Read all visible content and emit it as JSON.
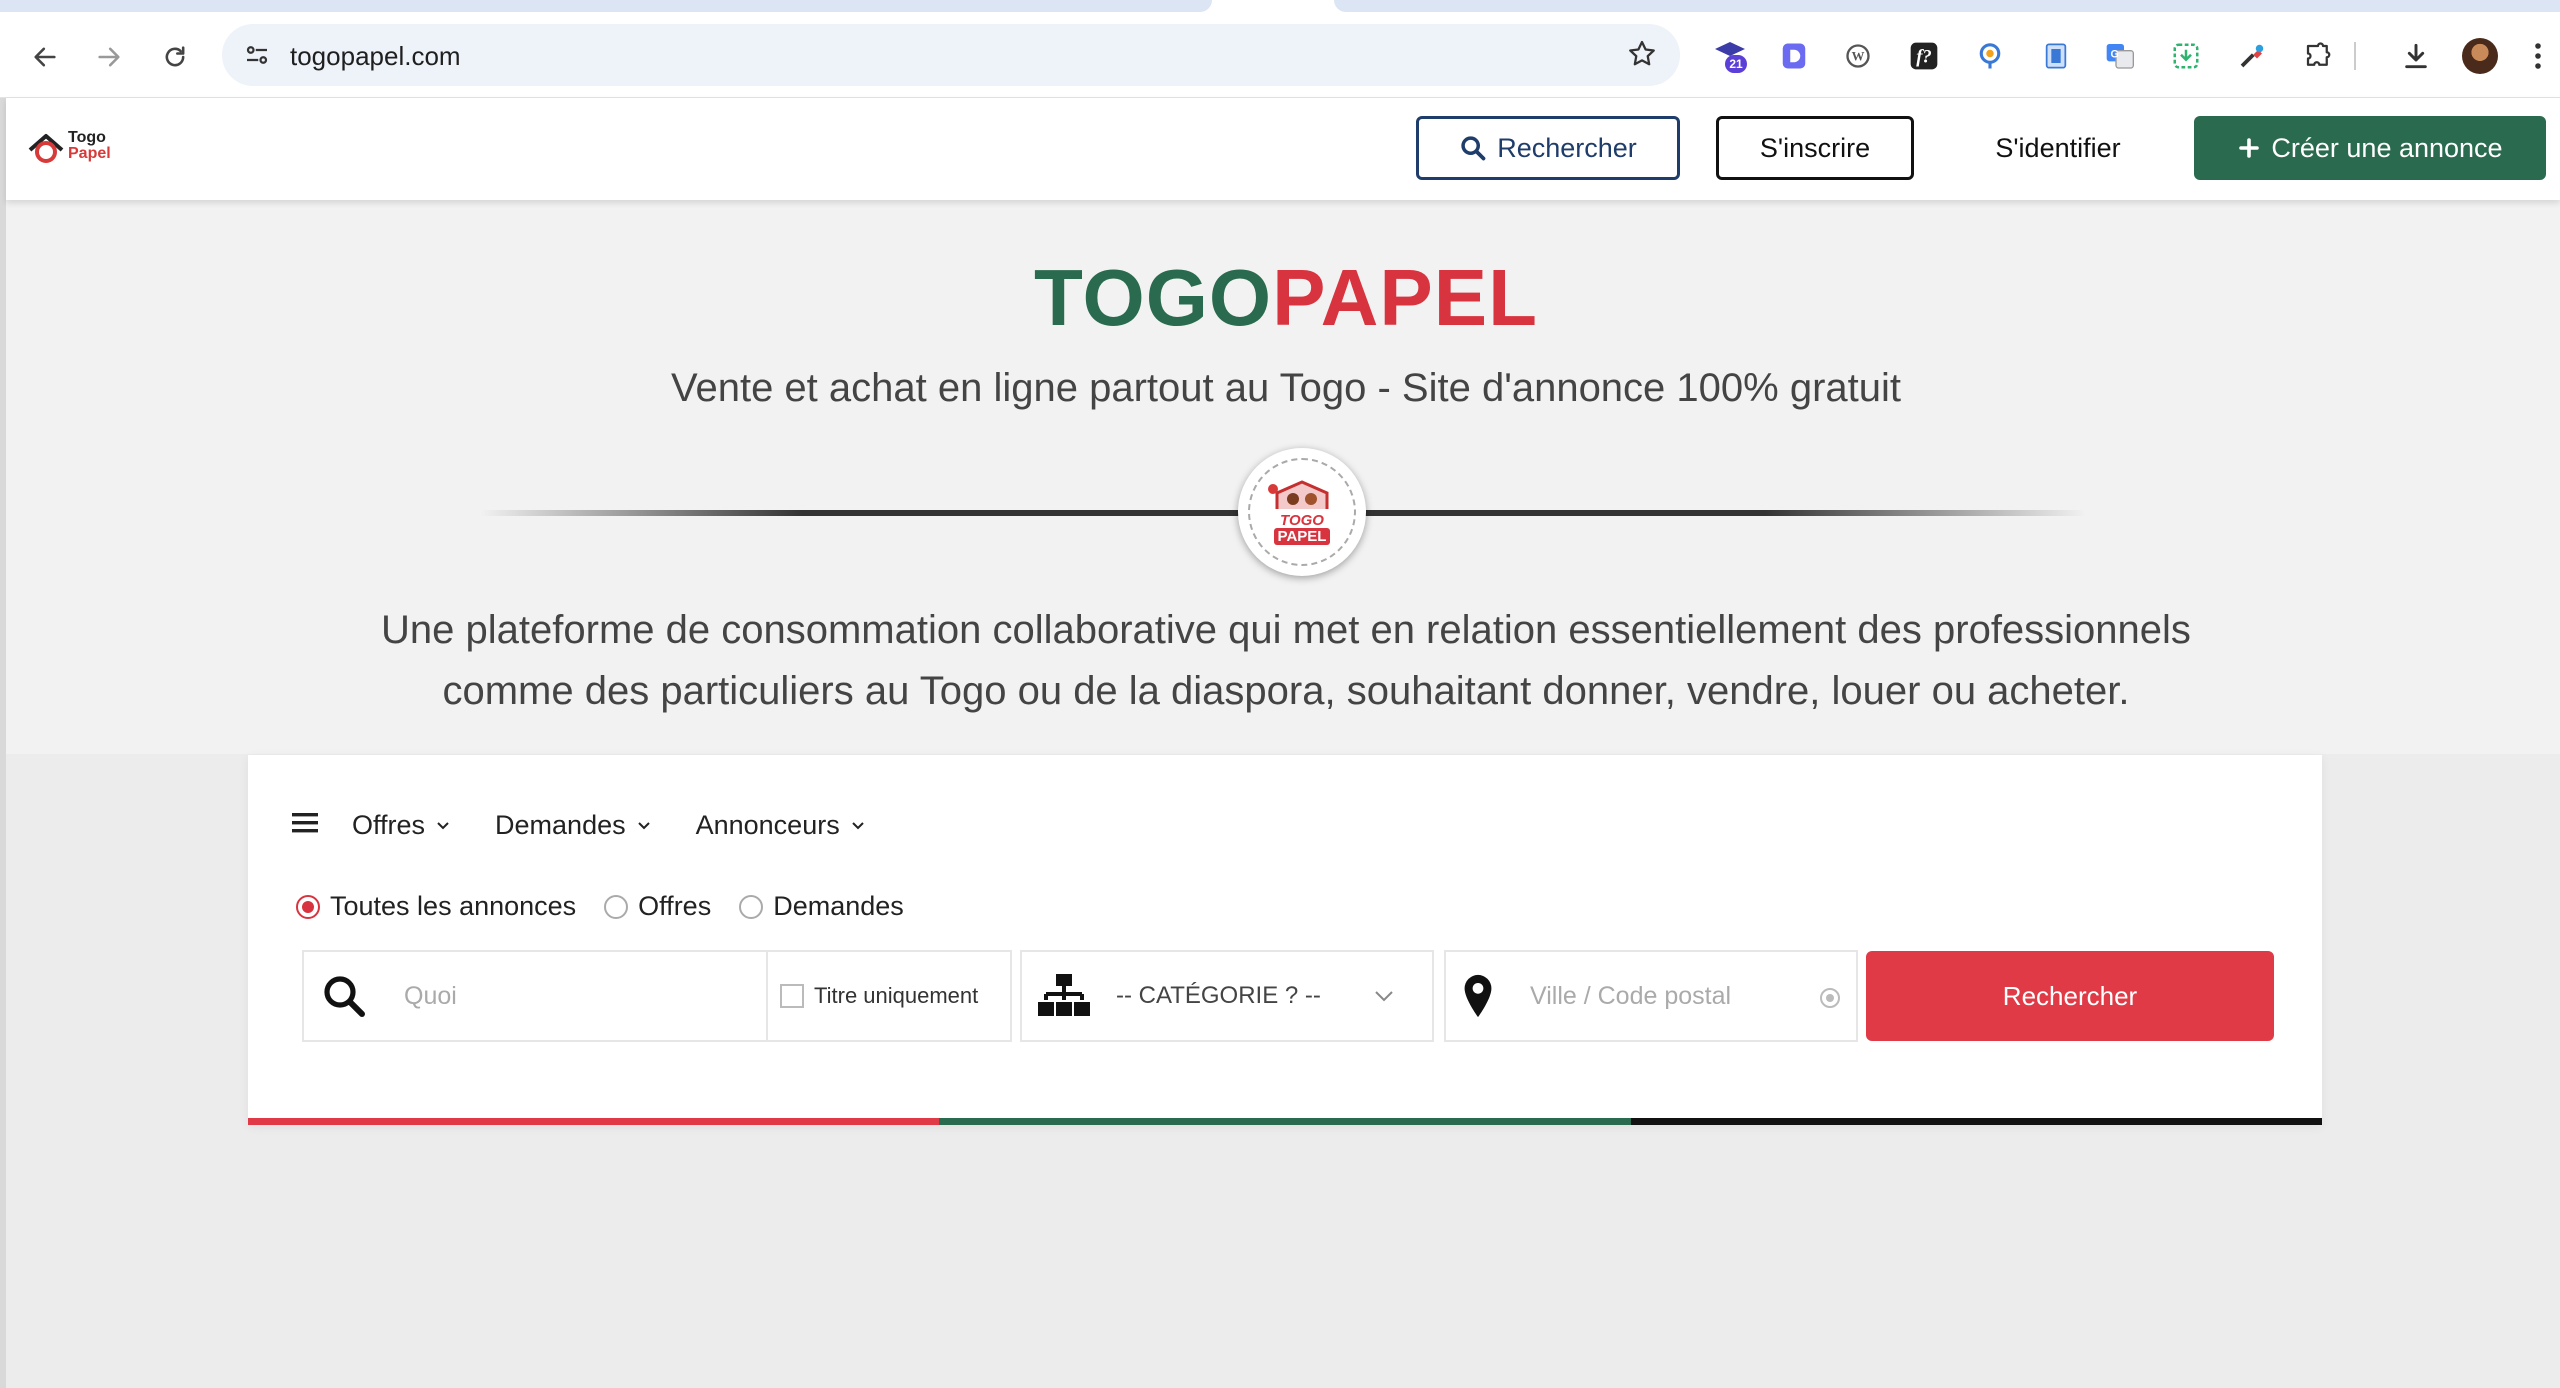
{
  "browser": {
    "url": "togopapel.com",
    "extension_badge": "21",
    "icons": [
      "back-icon",
      "forward-icon",
      "reload-icon",
      "site-info-icon",
      "bookmark-star-icon",
      "download-icon",
      "profile-avatar",
      "menu-kebab-icon"
    ]
  },
  "header": {
    "logo": {
      "line1": "Togo",
      "line2": "Papel"
    },
    "search_label": "Rechercher",
    "signup_label": "S'inscrire",
    "login_label": "S'identifier",
    "create_label": "Créer une annonce"
  },
  "hero": {
    "title_part1": "TOGO",
    "title_part2": "PAPEL",
    "subtitle": "Vente et achat en ligne partout au Togo - Site d'annonce 100% gratuit",
    "badge_line1": "TOGO",
    "badge_line2": "PAPEL",
    "description_line1": "Une plateforme de consommation collaborative qui met en relation essentiellement des professionnels",
    "description_line2": "comme des particuliers au Togo ou de la diaspora, souhaitant donner, vendre, louer ou acheter."
  },
  "search": {
    "menu": [
      "Offres",
      "Demandes",
      "Annonceurs"
    ],
    "radios": [
      {
        "label": "Toutes les annonces",
        "checked": true
      },
      {
        "label": "Offres",
        "checked": false
      },
      {
        "label": "Demandes",
        "checked": false
      }
    ],
    "what_placeholder": "Quoi",
    "title_only_label": "Titre uniquement",
    "category_label": "-- CATÉGORIE ? --",
    "city_placeholder": "Ville / Code postal",
    "submit_label": "Rechercher"
  },
  "colors": {
    "brand_green": "#2a6a4e",
    "brand_red": "#d8343f",
    "submit_red": "#e13a47",
    "navy": "#1f3d6b",
    "tricolor": [
      "#e13a47",
      "#2a6a4e",
      "#111111"
    ]
  }
}
